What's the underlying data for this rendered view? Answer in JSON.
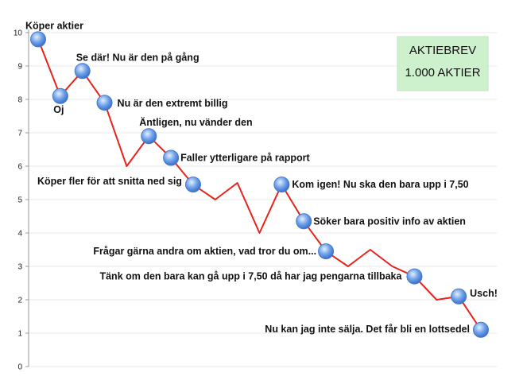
{
  "chart_data": {
    "type": "line",
    "title": "",
    "xlabel": "",
    "ylabel": "",
    "ylim": [
      0,
      10
    ],
    "yticks": [
      "0",
      "1",
      "2",
      "3",
      "4",
      "5",
      "6",
      "7",
      "8",
      "9",
      "10"
    ],
    "grid": "horizontal",
    "line_color": "#e8231c",
    "marker_color": "#6fa2e8",
    "series": [
      {
        "points": [
          {
            "x": 1,
            "y": 9.8,
            "marker": true,
            "label": "Köper aktier"
          },
          {
            "x": 2,
            "y": 8.1,
            "marker": true,
            "label": "Oj"
          },
          {
            "x": 3,
            "y": 8.85,
            "marker": true,
            "label": "Se där! Nu är den på gång"
          },
          {
            "x": 4,
            "y": 7.9,
            "marker": true,
            "label": "Nu är den extremt billig"
          },
          {
            "x": 5,
            "y": 6.0,
            "marker": false,
            "label": ""
          },
          {
            "x": 6,
            "y": 6.9,
            "marker": true,
            "label": "Äntligen, nu vänder den"
          },
          {
            "x": 7,
            "y": 6.25,
            "marker": true,
            "label": "Faller ytterligare på rapport"
          },
          {
            "x": 8,
            "y": 5.45,
            "marker": true,
            "label": "Köper fler för att snitta ned sig"
          },
          {
            "x": 9,
            "y": 5.0,
            "marker": false,
            "label": ""
          },
          {
            "x": 10,
            "y": 5.5,
            "marker": false,
            "label": ""
          },
          {
            "x": 11,
            "y": 4.0,
            "marker": false,
            "label": ""
          },
          {
            "x": 12,
            "y": 5.45,
            "marker": true,
            "label": "Kom igen! Nu ska den bara upp i 7,50"
          },
          {
            "x": 13,
            "y": 4.35,
            "marker": true,
            "label": "Söker bara positiv info av aktien"
          },
          {
            "x": 14,
            "y": 3.45,
            "marker": true,
            "label": "Frågar gärna andra om aktien, vad tror du om..."
          },
          {
            "x": 15,
            "y": 3.0,
            "marker": false,
            "label": ""
          },
          {
            "x": 16,
            "y": 3.5,
            "marker": false,
            "label": ""
          },
          {
            "x": 17,
            "y": 3.0,
            "marker": false,
            "label": ""
          },
          {
            "x": 18,
            "y": 2.7,
            "marker": true,
            "label": "Tänk om den bara kan gå upp i 7,50 då har jag pengarna tillbaka"
          },
          {
            "x": 19,
            "y": 2.0,
            "marker": false,
            "label": ""
          },
          {
            "x": 20,
            "y": 2.1,
            "marker": true,
            "label": "Usch!"
          },
          {
            "x": 21,
            "y": 1.1,
            "marker": true,
            "label": "Nu kan jag inte sälja. Det får bli en lottsedel"
          }
        ]
      }
    ],
    "infobox": {
      "lines": [
        "AKTIEBREV",
        "1.000 AKTIER"
      ],
      "background": "#cdf0cd"
    }
  }
}
